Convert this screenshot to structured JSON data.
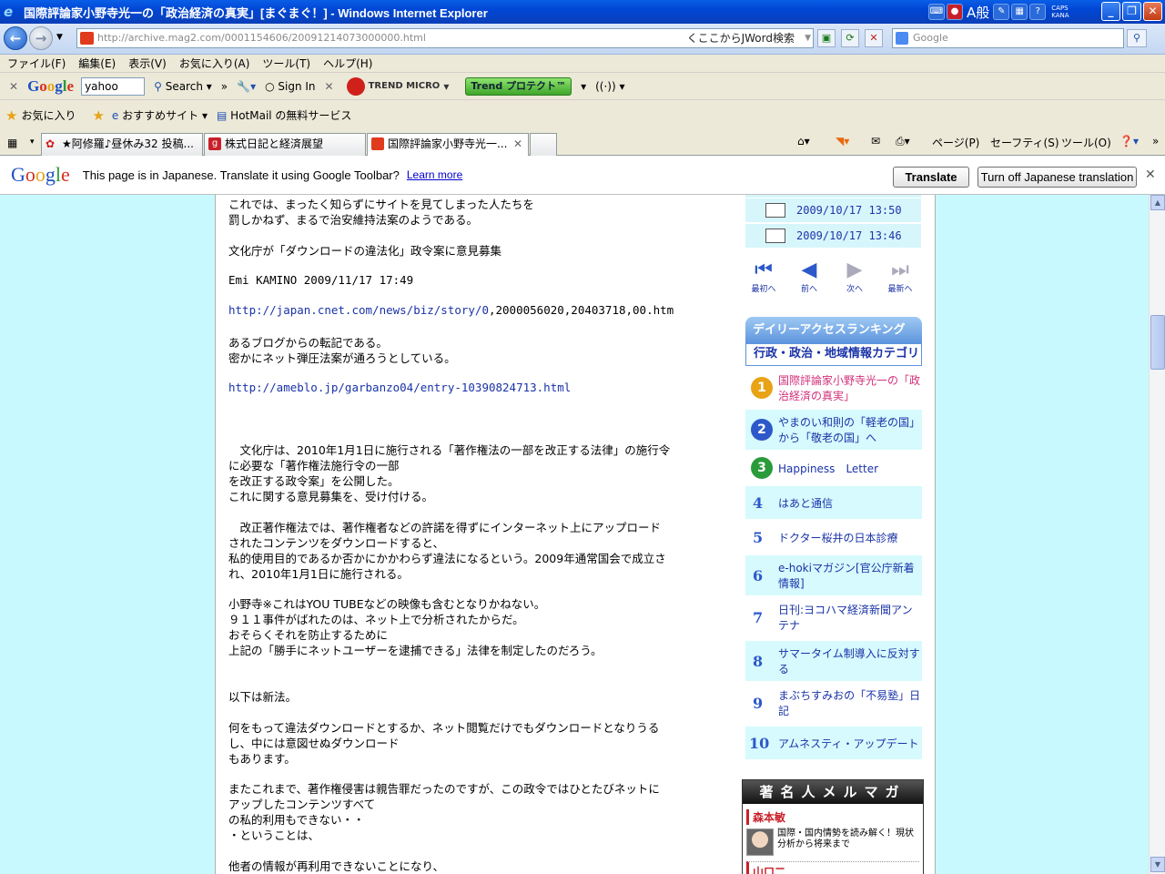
{
  "window": {
    "title": "国際評論家小野寺光一の「政治経済の真実」[まぐまぐ！] - Windows Internet Explorer",
    "tray_labels": [
      "CAPS",
      "KANA"
    ],
    "ime": "A般"
  },
  "address": {
    "url": "http://archive.mag2.com/0001154606/20091214073000000.html",
    "jword": "くここからJWord検索",
    "search_placeholder": "Google"
  },
  "menu": [
    "ファイル(F)",
    "編集(E)",
    "表示(V)",
    "お気に入り(A)",
    "ツール(T)",
    "ヘルプ(H)"
  ],
  "toolbar": {
    "search_value": "yahoo",
    "search_label": "Search",
    "sign_in": "Sign In",
    "trend": "TREND MICRO",
    "trend_protect": "Trend プロテクト™"
  },
  "favorites": {
    "label": "お気に入り",
    "items": [
      "おすすめサイト",
      "HotMail の無料サービス"
    ]
  },
  "tabs": [
    {
      "label": "★阿修羅♪昼休み32 投稿..."
    },
    {
      "label": "株式日記と経済展望"
    },
    {
      "label": "国際評論家小野寺光一..."
    }
  ],
  "commandbar": [
    "ページ(P)",
    "セーフティ(S)",
    "ツール(O)"
  ],
  "translate": {
    "logo": "Google",
    "message": "This page is in Japanese.  Translate it using Google Toolbar?",
    "learn_more": "Learn more",
    "translate_btn": "Translate",
    "turn_off_btn": "Turn off Japanese translation"
  },
  "article": {
    "lines": [
      "これでは、まったく知らずにサイトを見てしまった人たちを",
      "罰しかねず、まるで治安維持法案のようである。",
      "文化庁が「ダウンロードの違法化」政令案に意見募集",
      "Emi KAMINO 2009/11/17 17:49",
      "http://japan.cnet.com/news/biz/story/0",
      ",2000056020,20403718,00.htm",
      "あるブログからの転記である。",
      "密かにネット弾圧法案が通ろうとしている。",
      "http://ameblo.jp/garbanzo04/entry-10390824713.html",
      "　文化庁は、2010年1月1日に施行される「著作権法の一部を改正する法律」の施行令",
      "に必要な「著作権法施行令の一部",
      "を改正する政令案」を公開した。",
      "これに関する意見募集を、受け付ける。",
      "　改正著作権法では、著作権者などの許諾を得ずにインターネット上にアップロード",
      "されたコンテンツをダウンロードすると、",
      "私的使用目的であるか否かにかかわらず違法になるという。2009年通常国会で成立さ",
      "れ、2010年1月1日に施行される。",
      "小野寺※これはYOU TUBEなどの映像も含むとなりかねない。",
      "９１１事件がばれたのは、ネット上で分析されたからだ。",
      "おそらくそれを防止するために",
      "上記の「勝手にネットユーザーを逮捕できる」法律を制定したのだろう。",
      "以下は新法。",
      "何をもって違法ダウンロードとするか、ネット閲覧だけでもダウンロードとなりうる",
      "し、中には意図せぬダウンロード",
      "もあります。",
      "またこれまで、著作権侵害は親告罪だったのですが、この政令ではひとたびネットに",
      "アップしたコンテンツすべて",
      "の私的利用もできない・・",
      "・ということは、",
      "他者の情報が再利用できないことになり、"
    ]
  },
  "sidebar": {
    "dates": [
      "2009/10/17 13:50",
      "2009/10/17 13:46"
    ],
    "nav": [
      "最初へ",
      "前へ",
      "次へ",
      "最新へ"
    ],
    "ranking_title": "デイリーアクセスランキング",
    "ranking_category": "行政・政治・地域情報カテゴリ",
    "ranking": [
      {
        "num": "1",
        "title": "国際評論家小野寺光一の「政治経済の真実」"
      },
      {
        "num": "2",
        "title": "やまのい和則の「軽老の国」から「敬老の国」へ"
      },
      {
        "num": "3",
        "title": "Happiness　Letter"
      },
      {
        "num": "4",
        "title": "はあと通信"
      },
      {
        "num": "5",
        "title": "ドクター桜井の日本診療"
      },
      {
        "num": "6",
        "title": "e-hokiマガジン[官公庁新着情報]"
      },
      {
        "num": "7",
        "title": "日刊:ヨコハマ経済新聞アンテナ"
      },
      {
        "num": "8",
        "title": "サマータイム制導入に反対する"
      },
      {
        "num": "9",
        "title": "まぶちすみおの「不易塾」日記"
      },
      {
        "num": "10",
        "title": "アムネスティ・アップデート"
      }
    ],
    "famous_title": "著名人メルマガ",
    "famous_name": "森本敏",
    "famous_desc": "国際・国内情勢を読み解く！現状分析から将来まで",
    "famous_next": "山口二"
  },
  "colors": {
    "page_bg": "#c8f9ff",
    "link": "#1a33a8",
    "titlebar": "#0046d5"
  }
}
